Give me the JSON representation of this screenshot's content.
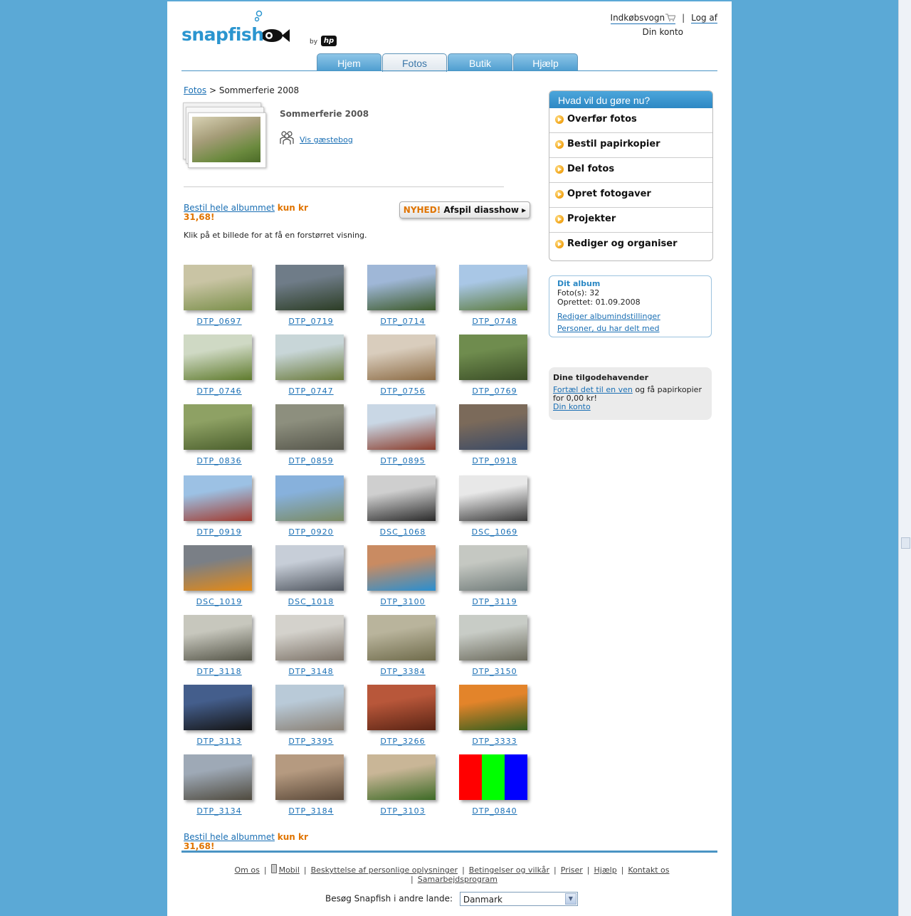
{
  "header": {
    "logo_text": "snapfish",
    "logo_by": "by",
    "logo_hp": "hp",
    "cart": "Indkøbsvogn",
    "logout": "Log af",
    "account": "Din konto"
  },
  "tabs": [
    "Hjem",
    "Fotos",
    "Butik",
    "Hjælp"
  ],
  "active_tab": "Fotos",
  "breadcrumb": {
    "root": "Fotos",
    "sep": ">",
    "current": "Sommerferie 2008"
  },
  "album": {
    "title": "Sommerferie 2008",
    "guestbook": "Vis gæstebog"
  },
  "order": {
    "link": "Bestil hele albummet",
    "price_prefix": "kun kr",
    "price": "31,68!"
  },
  "slideshow": {
    "new_label": "NYHED!",
    "label": "Afspil diasshow",
    "arrow": "▸"
  },
  "hint": "Klik på et billede for at få en forstørret visning.",
  "photos": [
    {
      "name": "DTP_0697",
      "colors": [
        "#c9c4a4",
        "#7a8f4a"
      ]
    },
    {
      "name": "DTP_0719",
      "colors": [
        "#6f7c88",
        "#2c3d25"
      ]
    },
    {
      "name": "DTP_0714",
      "colors": [
        "#9fb7d7",
        "#3d5a2a"
      ]
    },
    {
      "name": "DTP_0748",
      "colors": [
        "#a9c7e6",
        "#5b7a3c"
      ]
    },
    {
      "name": "DTP_0746",
      "colors": [
        "#cfd9c4",
        "#5f7b2d"
      ]
    },
    {
      "name": "DTP_0747",
      "colors": [
        "#c8d6d8",
        "#6a7a3a"
      ]
    },
    {
      "name": "DTP_0756",
      "colors": [
        "#d9cdbd",
        "#8c6b44"
      ]
    },
    {
      "name": "DTP_0769",
      "colors": [
        "#6f8c4e",
        "#3b4e27"
      ]
    },
    {
      "name": "DTP_0836",
      "colors": [
        "#8ea164",
        "#4b5f2d"
      ]
    },
    {
      "name": "DTP_0859",
      "colors": [
        "#8d8f7e",
        "#56564b"
      ]
    },
    {
      "name": "DTP_0895",
      "colors": [
        "#c9d7e5",
        "#8a3b2a"
      ]
    },
    {
      "name": "DTP_0918",
      "colors": [
        "#7b6a5a",
        "#3a4a66"
      ]
    },
    {
      "name": "DTP_0919",
      "colors": [
        "#9cc1e4",
        "#a13a2e"
      ]
    },
    {
      "name": "DTP_0920",
      "colors": [
        "#87b1dc",
        "#7a8a62"
      ]
    },
    {
      "name": "DSC_1068",
      "colors": [
        "#cfcfcf",
        "#2a2a2a"
      ]
    },
    {
      "name": "DSC_1069",
      "colors": [
        "#e8e8e8",
        "#3a3a3a"
      ]
    },
    {
      "name": "DSC_1019",
      "colors": [
        "#7a7f86",
        "#e68a14"
      ]
    },
    {
      "name": "DSC_1018",
      "colors": [
        "#c7ced8",
        "#4f555e"
      ]
    },
    {
      "name": "DTP_3100",
      "colors": [
        "#c98b62",
        "#2a8fd0"
      ]
    },
    {
      "name": "DTP_3119",
      "colors": [
        "#c5c8c2",
        "#6f7a78"
      ]
    },
    {
      "name": "DTP_3118",
      "colors": [
        "#c7c7bd",
        "#555548"
      ]
    },
    {
      "name": "DTP_3148",
      "colors": [
        "#d4d2cc",
        "#7d7368"
      ]
    },
    {
      "name": "DTP_3384",
      "colors": [
        "#b9b49c",
        "#6f6b4b"
      ]
    },
    {
      "name": "DTP_3150",
      "colors": [
        "#c8ccc6",
        "#6b6a5c"
      ]
    },
    {
      "name": "DTP_3113",
      "colors": [
        "#445e8c",
        "#151515"
      ]
    },
    {
      "name": "DTP_3395",
      "colors": [
        "#b9cad8",
        "#8a8074"
      ]
    },
    {
      "name": "DTP_3266",
      "colors": [
        "#b8573a",
        "#5a2414"
      ]
    },
    {
      "name": "DTP_3333",
      "colors": [
        "#e3842a",
        "#2f5d1e"
      ]
    },
    {
      "name": "DTP_3134",
      "colors": [
        "#9ea9b6",
        "#4f4a3e"
      ]
    },
    {
      "name": "DTP_3184",
      "colors": [
        "#b59a80",
        "#5a4838"
      ]
    },
    {
      "name": "DTP_3103",
      "colors": [
        "#c9b697",
        "#3d6a26"
      ]
    },
    {
      "name": "DTP_0840",
      "colors": [
        "#ff0000",
        "#00ff00",
        "#0000ff"
      ]
    }
  ],
  "actions": {
    "title": "Hvad vil du gøre nu?",
    "items": [
      "Overfør fotos",
      "Bestil papirkopier",
      "Del fotos",
      "Opret fotogaver",
      "Projekter",
      "Rediger og organiser"
    ]
  },
  "album_info": {
    "title": "Dit album",
    "photos_line": "Foto(s): 32",
    "created_line": "Oprettet: 01.09.2008",
    "edit_link": "Rediger albumindstillinger",
    "shared_link": "Personer, du har delt med"
  },
  "credits": {
    "title": "Dine tilgodehavender",
    "link": "Fortæl det til en ven",
    "text": "og få papirkopier for 0,00 kr!",
    "account_link": "Din konto"
  },
  "footer": {
    "links": [
      "Om os",
      "Mobil",
      "Beskyttelse af personlige oplysninger",
      "Betingelser og vilkår",
      "Priser",
      "Hjælp",
      "Kontakt os",
      "Samarbejdsprogram"
    ],
    "country_label": "Besøg Snapfish i andre lande:",
    "country_value": "Danmark"
  },
  "colors": {
    "background": "#5ba9d6",
    "brand": "#2b95cf",
    "link": "#1a6fb4",
    "price": "#e07400"
  }
}
